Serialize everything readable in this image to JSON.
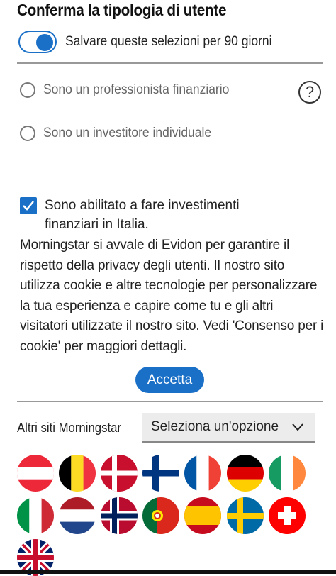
{
  "title": "Conferma la tipologia di utente",
  "toggle": {
    "label": "Salvare queste selezioni per 90 giorni",
    "checked": true
  },
  "options": [
    {
      "label": "Sono un professionista finanziario",
      "selected": false
    },
    {
      "label": "Sono un investitore individuale",
      "selected": false
    }
  ],
  "help_icon": "question-mark",
  "checkbox": {
    "label": "Sono abilitato a fare investimenti finanziari in Italia.",
    "checked": true
  },
  "paragraph": "Morningstar si avvale di Evidon per garantire il rispetto della privacy degli utenti. Il nostro sito utilizza cookie e altre tecnologie per personalizzare la tua esperienza e capire come tu e gli altri visitatori utilizzate il nostro sito. Vedi 'Consenso per i cookie' per maggiori dettagli.",
  "accept_button": "Accetta",
  "other_sites": {
    "label": "Altri siti Morningstar",
    "select_value": "Seleziona un'opzione"
  },
  "flags": [
    "austria",
    "belgium",
    "denmark",
    "finland",
    "france",
    "germany",
    "ireland",
    "italy",
    "netherlands",
    "norway",
    "portugal",
    "spain",
    "sweden",
    "switzerland",
    "united-kingdom"
  ],
  "colors": {
    "accent": "#1a6fc7",
    "divider": "#999999",
    "select_bg": "#ececec"
  }
}
